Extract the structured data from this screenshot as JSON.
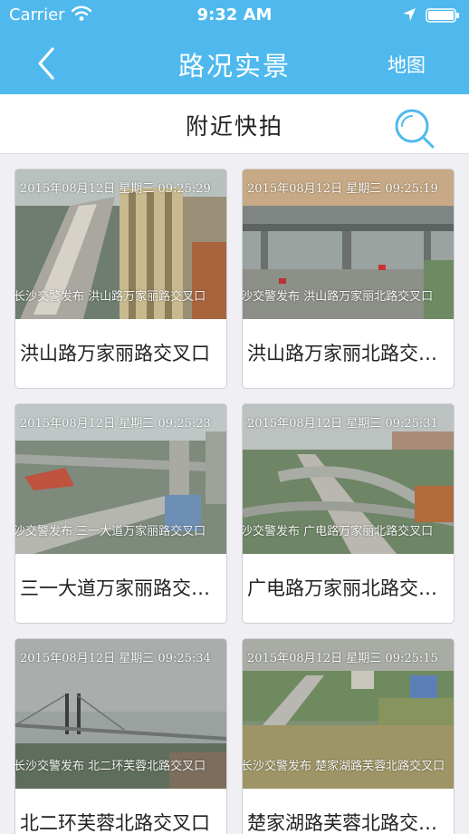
{
  "status_bar": {
    "carrier": "Carrier",
    "time": "9:32 AM"
  },
  "nav": {
    "title": "路况实景",
    "right_label": "地图"
  },
  "section": {
    "title": "附近快拍"
  },
  "snapshots": [
    {
      "timestamp": "2015年08月12日  星期三  09:25:29",
      "publisher": "长沙交警发布  洪山路万家丽路交叉口",
      "caption": "洪山路万家丽路交叉口"
    },
    {
      "timestamp": "2015年08月12日  星期三  09:25:19",
      "publisher": "沙交警发布  洪山路万家丽北路交叉口",
      "caption": "洪山路万家丽北路交叉口"
    },
    {
      "timestamp": "2015年08月12日  星期三  09:25:23",
      "publisher": "沙交警发布  三一大道万家丽路交叉口",
      "caption": "三一大道万家丽路交叉口"
    },
    {
      "timestamp": "2015年08月12日  星期三  09:25:31",
      "publisher": "沙交警发布  广电路万家丽北路交叉口",
      "caption": "广电路万家丽北路交叉口"
    },
    {
      "timestamp": "2015年08月12日  星期三  09:25:34",
      "publisher": "长沙交警发布  北二环芙蓉北路交叉口",
      "caption": "北二环芙蓉北路交叉口"
    },
    {
      "timestamp": "2015年08月12日  星期三  09:25:15",
      "publisher": "长沙交警发布  楚家湖路芙蓉北路交叉口",
      "caption": "楚家湖路芙蓉北路交叉口"
    }
  ],
  "icons": {
    "back": "chevron-left-icon",
    "search": "search-icon",
    "wifi": "wifi-icon",
    "location": "location-arrow-icon",
    "battery": "battery-icon"
  },
  "colors": {
    "nav_bar": "#4fb9ee",
    "search_icon": "#4fb9ee",
    "background": "#efeff4"
  }
}
